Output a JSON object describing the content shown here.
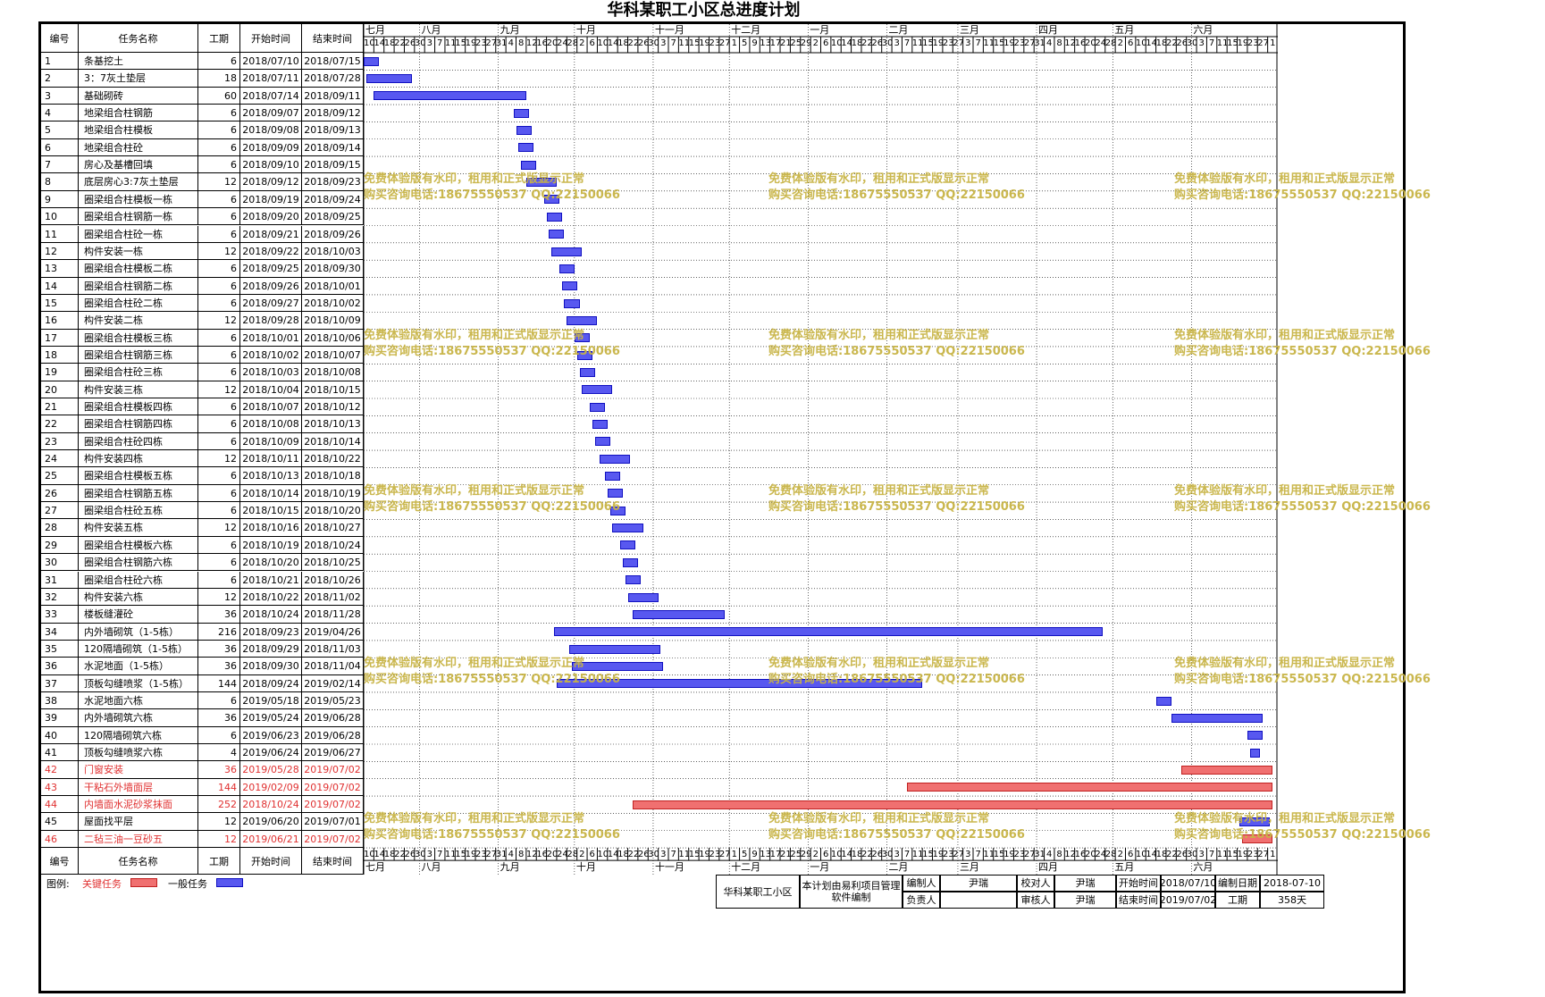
{
  "title": "华科某职工小区总进度计划",
  "columns": {
    "id": "编号",
    "name": "任务名称",
    "duration": "工期",
    "start": "开始时间",
    "end": "结束时间"
  },
  "months": [
    "七月",
    "八月",
    "九月",
    "十月",
    "十一月",
    "十二月",
    "一月",
    "二月",
    "三月",
    "四月",
    "五月",
    "六月"
  ],
  "tasks": [
    {
      "id": "1",
      "name": "条基挖土",
      "duration": "6",
      "start": "2018/07/10",
      "end": "2018/07/15",
      "critical": false
    },
    {
      "id": "2",
      "name": "3：7灰土垫层",
      "duration": "18",
      "start": "2018/07/11",
      "end": "2018/07/28",
      "critical": false
    },
    {
      "id": "3",
      "name": "基础砌砖",
      "duration": "60",
      "start": "2018/07/14",
      "end": "2018/09/11",
      "critical": false
    },
    {
      "id": "4",
      "name": "地梁组合柱钢筋",
      "duration": "6",
      "start": "2018/09/07",
      "end": "2018/09/12",
      "critical": false
    },
    {
      "id": "5",
      "name": "地梁组合柱模板",
      "duration": "6",
      "start": "2018/09/08",
      "end": "2018/09/13",
      "critical": false
    },
    {
      "id": "6",
      "name": "地梁组合柱砼",
      "duration": "6",
      "start": "2018/09/09",
      "end": "2018/09/14",
      "critical": false
    },
    {
      "id": "7",
      "name": "房心及基槽回填",
      "duration": "6",
      "start": "2018/09/10",
      "end": "2018/09/15",
      "critical": false
    },
    {
      "id": "8",
      "name": "底层房心3:7灰土垫层",
      "duration": "12",
      "start": "2018/09/12",
      "end": "2018/09/23",
      "critical": false
    },
    {
      "id": "9",
      "name": "圈梁组合柱模板一栋",
      "duration": "6",
      "start": "2018/09/19",
      "end": "2018/09/24",
      "critical": false
    },
    {
      "id": "10",
      "name": "圈梁组合柱钢筋一栋",
      "duration": "6",
      "start": "2018/09/20",
      "end": "2018/09/25",
      "critical": false
    },
    {
      "id": "11",
      "name": "圈梁组合柱砼一栋",
      "duration": "6",
      "start": "2018/09/21",
      "end": "2018/09/26",
      "critical": false
    },
    {
      "id": "12",
      "name": "构件安装一栋",
      "duration": "12",
      "start": "2018/09/22",
      "end": "2018/10/03",
      "critical": false
    },
    {
      "id": "13",
      "name": "圈梁组合柱模板二栋",
      "duration": "6",
      "start": "2018/09/25",
      "end": "2018/09/30",
      "critical": false
    },
    {
      "id": "14",
      "name": "圈梁组合柱钢筋二栋",
      "duration": "6",
      "start": "2018/09/26",
      "end": "2018/10/01",
      "critical": false
    },
    {
      "id": "15",
      "name": "圈梁组合柱砼二栋",
      "duration": "6",
      "start": "2018/09/27",
      "end": "2018/10/02",
      "critical": false
    },
    {
      "id": "16",
      "name": "构件安装二栋",
      "duration": "12",
      "start": "2018/09/28",
      "end": "2018/10/09",
      "critical": false
    },
    {
      "id": "17",
      "name": "圈梁组合柱模板三栋",
      "duration": "6",
      "start": "2018/10/01",
      "end": "2018/10/06",
      "critical": false
    },
    {
      "id": "18",
      "name": "圈梁组合柱钢筋三栋",
      "duration": "6",
      "start": "2018/10/02",
      "end": "2018/10/07",
      "critical": false
    },
    {
      "id": "19",
      "name": "圈梁组合柱砼三栋",
      "duration": "6",
      "start": "2018/10/03",
      "end": "2018/10/08",
      "critical": false
    },
    {
      "id": "20",
      "name": "构件安装三栋",
      "duration": "12",
      "start": "2018/10/04",
      "end": "2018/10/15",
      "critical": false
    },
    {
      "id": "21",
      "name": "圈梁组合柱模板四栋",
      "duration": "6",
      "start": "2018/10/07",
      "end": "2018/10/12",
      "critical": false
    },
    {
      "id": "22",
      "name": "圈梁组合柱钢筋四栋",
      "duration": "6",
      "start": "2018/10/08",
      "end": "2018/10/13",
      "critical": false
    },
    {
      "id": "23",
      "name": "圈梁组合柱砼四栋",
      "duration": "6",
      "start": "2018/10/09",
      "end": "2018/10/14",
      "critical": false
    },
    {
      "id": "24",
      "name": "构件安装四栋",
      "duration": "12",
      "start": "2018/10/11",
      "end": "2018/10/22",
      "critical": false
    },
    {
      "id": "25",
      "name": "圈梁组合柱模板五栋",
      "duration": "6",
      "start": "2018/10/13",
      "end": "2018/10/18",
      "critical": false
    },
    {
      "id": "26",
      "name": "圈梁组合柱钢筋五栋",
      "duration": "6",
      "start": "2018/10/14",
      "end": "2018/10/19",
      "critical": false
    },
    {
      "id": "27",
      "name": "圈梁组合柱砼五栋",
      "duration": "6",
      "start": "2018/10/15",
      "end": "2018/10/20",
      "critical": false
    },
    {
      "id": "28",
      "name": "构件安装五栋",
      "duration": "12",
      "start": "2018/10/16",
      "end": "2018/10/27",
      "critical": false
    },
    {
      "id": "29",
      "name": "圈梁组合柱模板六栋",
      "duration": "6",
      "start": "2018/10/19",
      "end": "2018/10/24",
      "critical": false
    },
    {
      "id": "30",
      "name": "圈梁组合柱钢筋六栋",
      "duration": "6",
      "start": "2018/10/20",
      "end": "2018/10/25",
      "critical": false
    },
    {
      "id": "31",
      "name": "圈梁组合柱砼六栋",
      "duration": "6",
      "start": "2018/10/21",
      "end": "2018/10/26",
      "critical": false
    },
    {
      "id": "32",
      "name": "构件安装六栋",
      "duration": "12",
      "start": "2018/10/22",
      "end": "2018/11/02",
      "critical": false
    },
    {
      "id": "33",
      "name": "楼板缝灌砼",
      "duration": "36",
      "start": "2018/10/24",
      "end": "2018/11/28",
      "critical": false
    },
    {
      "id": "34",
      "name": "内外墙砌筑（1-5栋）",
      "duration": "216",
      "start": "2018/09/23",
      "end": "2019/04/26",
      "critical": false
    },
    {
      "id": "35",
      "name": "120隔墙砌筑（1-5栋）",
      "duration": "36",
      "start": "2018/09/29",
      "end": "2018/11/03",
      "critical": false
    },
    {
      "id": "36",
      "name": "水泥地面（1-5栋）",
      "duration": "36",
      "start": "2018/09/30",
      "end": "2018/11/04",
      "critical": false
    },
    {
      "id": "37",
      "name": "顶板勾缝喷浆（1-5栋）",
      "duration": "144",
      "start": "2018/09/24",
      "end": "2019/02/14",
      "critical": false
    },
    {
      "id": "38",
      "name": "水泥地面六栋",
      "duration": "6",
      "start": "2019/05/18",
      "end": "2019/05/23",
      "critical": false
    },
    {
      "id": "39",
      "name": "内外墙砌筑六栋",
      "duration": "36",
      "start": "2019/05/24",
      "end": "2019/06/28",
      "critical": false
    },
    {
      "id": "40",
      "name": "120隔墙砌筑六栋",
      "duration": "6",
      "start": "2019/06/23",
      "end": "2019/06/28",
      "critical": false
    },
    {
      "id": "41",
      "name": "顶板勾缝喷浆六栋",
      "duration": "4",
      "start": "2019/06/24",
      "end": "2019/06/27",
      "critical": false
    },
    {
      "id": "42",
      "name": "门窗安装",
      "duration": "36",
      "start": "2019/05/28",
      "end": "2019/07/02",
      "critical": true
    },
    {
      "id": "43",
      "name": "干粘石外墙面层",
      "duration": "144",
      "start": "2019/02/09",
      "end": "2019/07/02",
      "critical": true
    },
    {
      "id": "44",
      "name": "内墙面水泥砂浆抹面",
      "duration": "252",
      "start": "2018/10/24",
      "end": "2019/07/02",
      "critical": true
    },
    {
      "id": "45",
      "name": "屋面找平层",
      "duration": "12",
      "start": "2019/06/20",
      "end": "2019/07/01",
      "critical": false
    },
    {
      "id": "46",
      "name": "二毡三油一豆砂五",
      "duration": "12",
      "start": "2019/06/21",
      "end": "2019/07/02",
      "critical": true
    }
  ],
  "watermark": {
    "line1": "免费体验版有水印，租用和正式版显示正常",
    "line2": "购买咨询电话:18675550537 QQ:22150066"
  },
  "legend": {
    "label": "图例:",
    "critical": "关键任务",
    "normal": "一般任务"
  },
  "footer": {
    "project": "华科某职工小区",
    "software": "本计划由易利项目管理软件编制",
    "author_label": "编制人",
    "author": "尹瑞",
    "checker_label": "校对人",
    "checker": "尹瑞",
    "start_label": "开始时间",
    "start": "2018/07/10",
    "date_label": "编制日期",
    "date": "2018-07-10",
    "owner_label": "负责人",
    "owner": "",
    "reviewer_label": "审核人",
    "reviewer": "尹瑞",
    "end_label": "结束时间",
    "end": "2019/07/02",
    "duration_label": "工期",
    "duration": "358天"
  },
  "colors": {
    "normal_bar": "#5858f0",
    "critical_bar": "#f07070",
    "critical_text": "#e03030",
    "watermark": "#c8b445"
  }
}
